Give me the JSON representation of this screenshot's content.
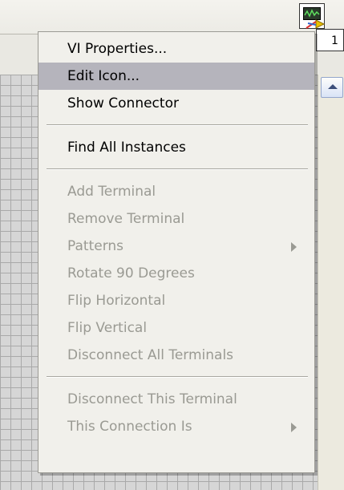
{
  "connector": {
    "label": "1"
  },
  "menu": {
    "group1": [
      {
        "label": "VI Properties...",
        "enabled": true
      },
      {
        "label": "Edit Icon...",
        "enabled": true,
        "highlighted": true
      },
      {
        "label": "Show Connector",
        "enabled": true
      }
    ],
    "group2": [
      {
        "label": "Find All Instances",
        "enabled": true
      }
    ],
    "group3": [
      {
        "label": "Add Terminal",
        "enabled": false
      },
      {
        "label": "Remove Terminal",
        "enabled": false
      },
      {
        "label": "Patterns",
        "enabled": false,
        "submenu": true
      },
      {
        "label": "Rotate 90 Degrees",
        "enabled": false
      },
      {
        "label": "Flip Horizontal",
        "enabled": false
      },
      {
        "label": "Flip Vertical",
        "enabled": false
      },
      {
        "label": "Disconnect All Terminals",
        "enabled": false
      }
    ],
    "group4": [
      {
        "label": "Disconnect This Terminal",
        "enabled": false
      },
      {
        "label": "This Connection Is",
        "enabled": false,
        "submenu": true
      }
    ]
  },
  "colors": {
    "menu_bg": "#f1f0eb",
    "highlight": "#b5b4bc",
    "disabled_text": "#9a9a93"
  }
}
